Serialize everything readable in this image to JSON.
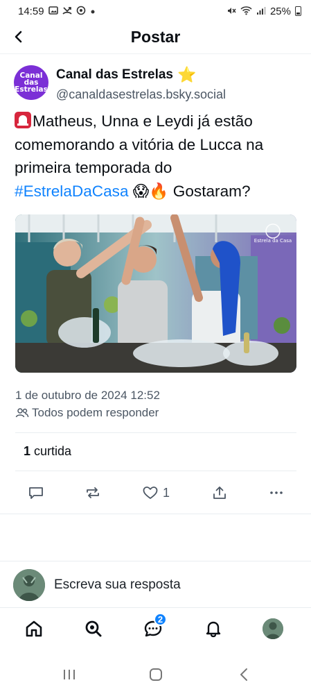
{
  "status_bar": {
    "time": "14:59",
    "battery": "25%",
    "icons_left": [
      "gallery-icon",
      "missed-call-icon",
      "vpn-icon",
      "dot-icon"
    ],
    "icons_right": [
      "mute-icon",
      "wifi-icon",
      "signal-icon",
      "battery-icon"
    ]
  },
  "header": {
    "title": "Postar",
    "back_icon": "back-arrow-icon"
  },
  "author": {
    "avatar_text_1": "Canal das",
    "avatar_text_2": "Estrelas",
    "name": "Canal das Estrelas",
    "name_emoji": "⭐",
    "handle": "@canaldasestrelas.bsky.social"
  },
  "post": {
    "text_main": "Matheus, Unna e Leydi já estão comemorando a vitória de Lucca na primeira temporada do",
    "hashtag": "#EstrelaDaCasa",
    "text_end": "Gostaram?",
    "emojis": "😱🔥",
    "image_watermark": "Estrela da Casa",
    "date": "1 de outubro de 2024 12:52",
    "reply_setting": "Todos podem responder"
  },
  "engagement": {
    "likes_count": "1",
    "likes_label": "curtida"
  },
  "actions": {
    "like_count": "1",
    "items": [
      "reply-icon",
      "repost-icon",
      "like-icon",
      "share-icon",
      "more-icon"
    ]
  },
  "reply": {
    "placeholder": "Escreva sua resposta"
  },
  "bottom_nav": {
    "chat_badge": "2"
  },
  "colors": {
    "accent": "#1083fe",
    "text": "#0b0f14",
    "muted": "#4b5663",
    "avatar_purple": "#7b2fd6",
    "divider": "#e9edf0"
  }
}
